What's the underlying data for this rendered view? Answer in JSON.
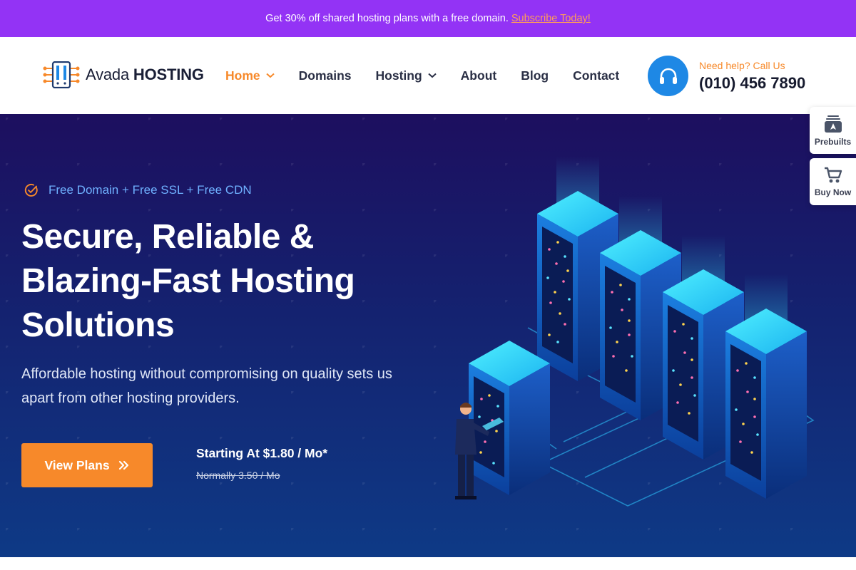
{
  "promo": {
    "text": "Get 30% off shared hosting plans with a free domain.",
    "link": "Subscribe Today!"
  },
  "header": {
    "logo_light": "Avada",
    "logo_bold": "HOSTING",
    "nav": [
      {
        "label": "Home",
        "active": true,
        "dropdown": true
      },
      {
        "label": "Domains"
      },
      {
        "label": "Hosting",
        "dropdown": true
      },
      {
        "label": "About"
      },
      {
        "label": "Blog"
      },
      {
        "label": "Contact"
      }
    ],
    "help_label": "Need help? Call Us",
    "help_phone": "(010) 456 7890",
    "help_icon": "headset-icon"
  },
  "side": {
    "prebuilts": "Prebuilts",
    "buy_now": "Buy Now"
  },
  "hero": {
    "tagline": "Free Domain + Free SSL + Free CDN",
    "headline_1": "Secure, Reliable &",
    "headline_2": "Blazing-Fast Hosting",
    "headline_3": "Solutions",
    "subtext": "Affordable hosting without compromising on quality sets us apart from other hosting providers.",
    "cta": "View Plans",
    "price": "Starting At $1.80 / Mo*",
    "price_old": "Normally 3.50 / Mo"
  },
  "colors": {
    "promo_bg": "#9333f5",
    "accent_orange": "#f7892a",
    "help_blue": "#1e88e5",
    "hero_top": "#1d0f5f",
    "hero_bottom": "#0e3a86",
    "tagline_blue": "#6fb1ff"
  }
}
